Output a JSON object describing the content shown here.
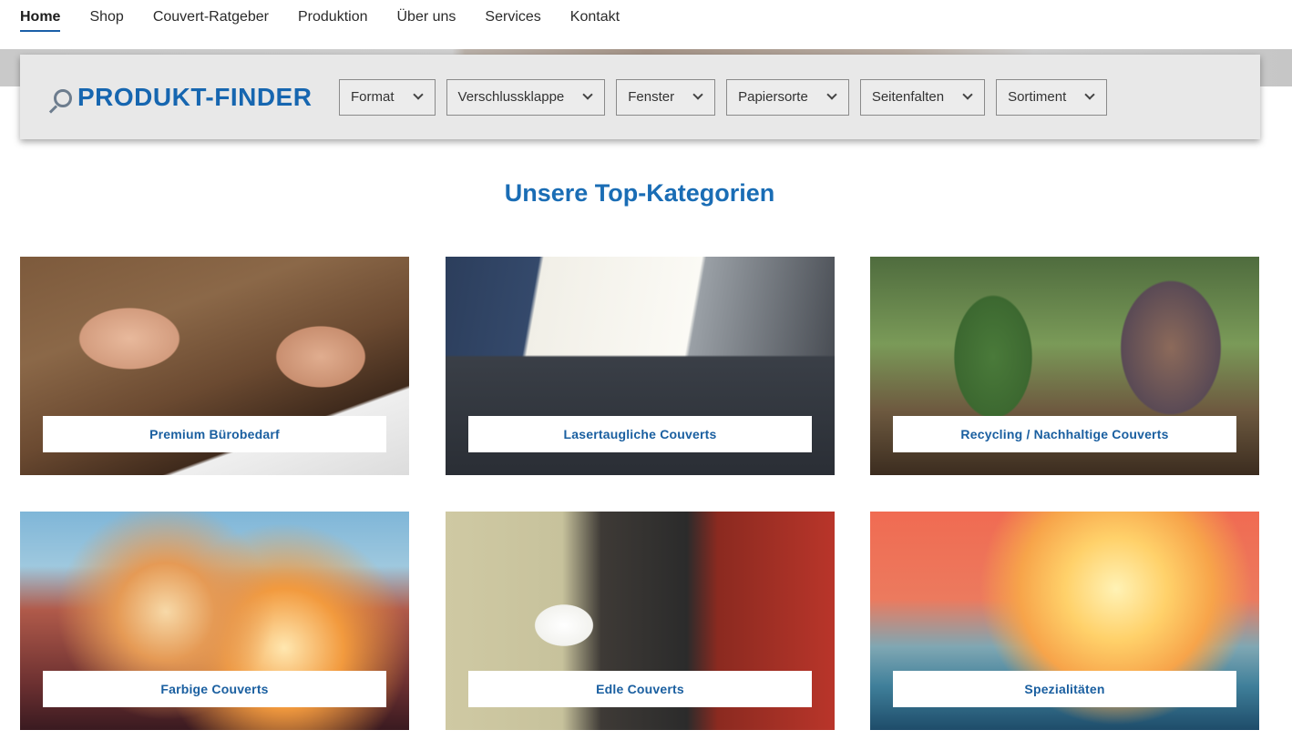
{
  "nav": {
    "items": [
      {
        "label": "Home",
        "active": true
      },
      {
        "label": "Shop",
        "active": false
      },
      {
        "label": "Couvert-Ratgeber",
        "active": false
      },
      {
        "label": "Produktion",
        "active": false
      },
      {
        "label": "Über uns",
        "active": false
      },
      {
        "label": "Services",
        "active": false
      },
      {
        "label": "Kontakt",
        "active": false
      }
    ]
  },
  "finder": {
    "title": "PRODUKT-FINDER",
    "icon": "search-icon",
    "filters": [
      {
        "label": "Format"
      },
      {
        "label": "Verschlussklappe"
      },
      {
        "label": "Fenster"
      },
      {
        "label": "Papiersorte"
      },
      {
        "label": "Seitenfalten"
      },
      {
        "label": "Sortiment"
      }
    ]
  },
  "section": {
    "title": "Unsere Top-Kategorien"
  },
  "categories": [
    {
      "label": "Premium Bürobedarf"
    },
    {
      "label": "Lasertaugliche Couverts"
    },
    {
      "label": "Recycling / Nachhaltige Couverts"
    },
    {
      "label": "Farbige Couverts"
    },
    {
      "label": "Edle Couverts"
    },
    {
      "label": "Spezialitäten"
    }
  ],
  "colors": {
    "brand_blue": "#1666b0",
    "finder_bg": "#e8e8e8"
  }
}
